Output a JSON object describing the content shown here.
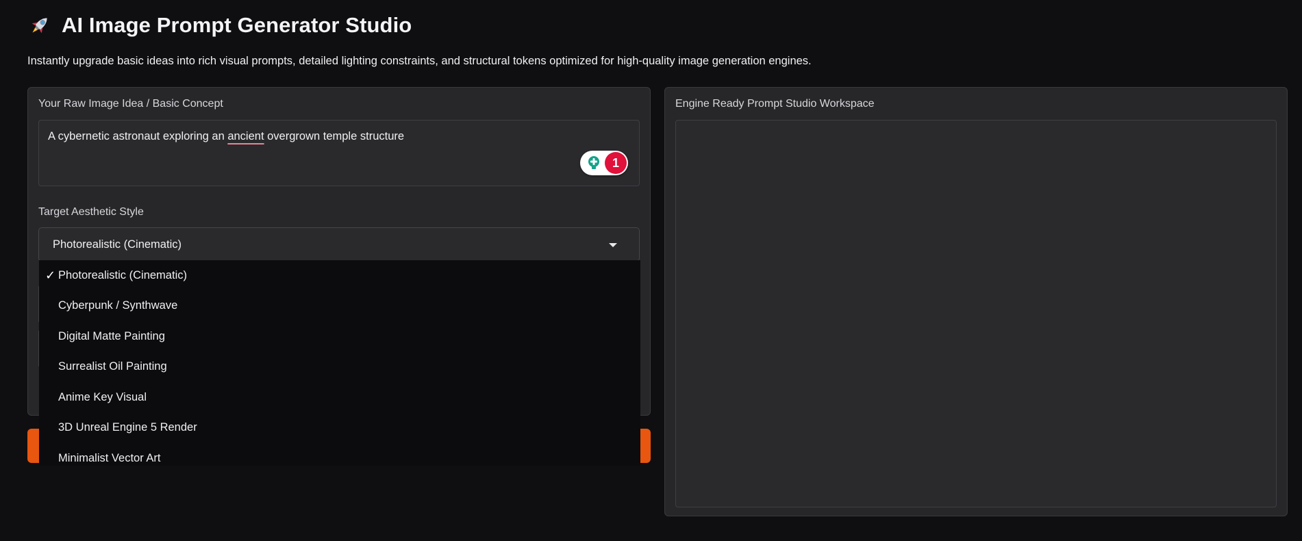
{
  "header": {
    "title": "AI Image Prompt Generator Studio",
    "subtitle": "Instantly upgrade basic ideas into rich visual prompts, detailed lighting constraints, and structural tokens optimized for high-quality image generation engines."
  },
  "left_panel": {
    "idea_label": "Your Raw Image Idea / Basic Concept",
    "idea_value": {
      "before": "A cybernetic astronaut exploring an ",
      "flagged_word": "ancient",
      "after": " overgrown temple structure"
    },
    "grammar_badge": {
      "count": "1"
    },
    "style_label": "Target Aesthetic Style",
    "style_selected": "Photorealistic (Cinematic)",
    "style_options": [
      "Photorealistic (Cinematic)",
      "Cyberpunk / Synthwave",
      "Digital Matte Painting",
      "Surrealist Oil Painting",
      "Anime Key Visual",
      "3D Unreal Engine 5 Render",
      "Minimalist Vector Art"
    ],
    "check_mark": "✓"
  },
  "right_panel": {
    "output_label": "Engine Ready Prompt Studio Workspace",
    "output_value": ""
  },
  "colors": {
    "accent_orange": "#e8560f",
    "badge_red": "#e0113a",
    "bulb_teal": "#14a38b"
  },
  "icons": {
    "title_icon": "rocket-icon",
    "badge_icon": "lightbulb-icon",
    "select_icon": "caret-down-icon"
  }
}
